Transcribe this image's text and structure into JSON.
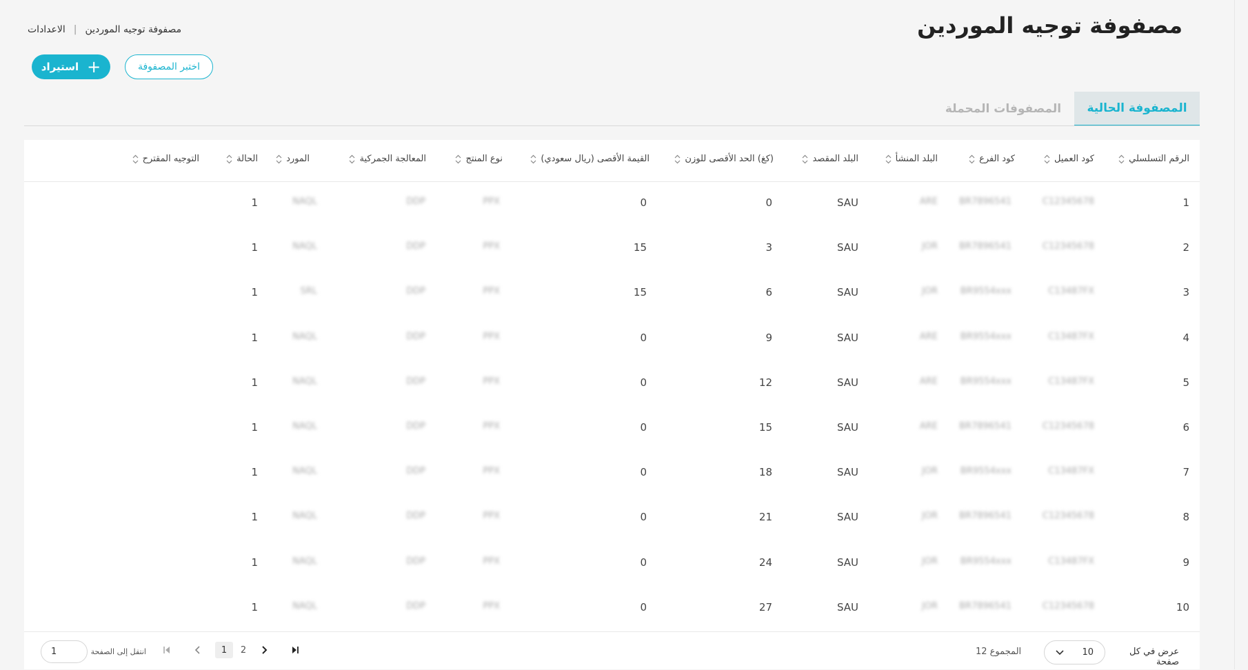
{
  "header": {
    "title": "مصفوفة توجيه الموردين",
    "breadcrumb": [
      "الاعدادات",
      "مصفوفة توجيه الموردين"
    ],
    "breadcrumb_separator": "|"
  },
  "actions": {
    "import_label": "استيراد",
    "choose_matrix_label": "اختبر المصفوفة"
  },
  "tabs": [
    {
      "label": "المصفوفة الحالية",
      "active": true
    },
    {
      "label": "المصفوفات المحملة",
      "active": false
    }
  ],
  "table": {
    "columns": [
      "الرقم التسلسلي",
      "كود العميل",
      "كود الفرع",
      "البلد المنشأ",
      "البلد المقصد",
      "(كغ) الحد الأقصى للوزن",
      "القيمة الأقصى (ريال سعودي)",
      "نوع المنتج",
      "المعالجة الجمركية",
      "المورد",
      "الحالة",
      "التوجيه المقترح"
    ],
    "rows": [
      {
        "serial": "1",
        "client": "C12345678",
        "branch": "BR7896541",
        "origin": "ARE",
        "dest": "SAU",
        "max_weight": "0",
        "max_value": "0",
        "product": "PPX",
        "customs": "DDP",
        "supplier": "NAQL",
        "status": "1"
      },
      {
        "serial": "2",
        "client": "C12345678",
        "branch": "BR7896541",
        "origin": "JOR",
        "dest": "SAU",
        "max_weight": "3",
        "max_value": "15",
        "product": "PPX",
        "customs": "DDP",
        "supplier": "NAQL",
        "status": "1"
      },
      {
        "serial": "3",
        "client": "C13487FX",
        "branch": "BR9554xxx",
        "origin": "JOR",
        "dest": "SAU",
        "max_weight": "6",
        "max_value": "15",
        "product": "PPX",
        "customs": "DDP",
        "supplier": "SRL",
        "status": "1"
      },
      {
        "serial": "4",
        "client": "C13487FX",
        "branch": "BR9554xxx",
        "origin": "ARE",
        "dest": "SAU",
        "max_weight": "9",
        "max_value": "0",
        "product": "PPX",
        "customs": "DDP",
        "supplier": "NAQL",
        "status": "1"
      },
      {
        "serial": "5",
        "client": "C13487FX",
        "branch": "BR9554xxx",
        "origin": "ARE",
        "dest": "SAU",
        "max_weight": "12",
        "max_value": "0",
        "product": "PPX",
        "customs": "DDP",
        "supplier": "NAQL",
        "status": "1"
      },
      {
        "serial": "6",
        "client": "C12345678",
        "branch": "BR7896541",
        "origin": "ARE",
        "dest": "SAU",
        "max_weight": "15",
        "max_value": "0",
        "product": "PPX",
        "customs": "DDP",
        "supplier": "NAQL",
        "status": "1"
      },
      {
        "serial": "7",
        "client": "C13487FX",
        "branch": "BR9554xxx",
        "origin": "JOR",
        "dest": "SAU",
        "max_weight": "18",
        "max_value": "0",
        "product": "PPX",
        "customs": "DDP",
        "supplier": "NAQL",
        "status": "1"
      },
      {
        "serial": "8",
        "client": "C12345678",
        "branch": "BR7896541",
        "origin": "JOR",
        "dest": "SAU",
        "max_weight": "21",
        "max_value": "0",
        "product": "PPX",
        "customs": "DDP",
        "supplier": "NAQL",
        "status": "1"
      },
      {
        "serial": "9",
        "client": "C13487FX",
        "branch": "BR9554xxx",
        "origin": "JOR",
        "dest": "SAU",
        "max_weight": "24",
        "max_value": "0",
        "product": "PPX",
        "customs": "DDP",
        "supplier": "NAQL",
        "status": "1"
      },
      {
        "serial": "10",
        "client": "C12345678",
        "branch": "BR7896541",
        "origin": "JOR",
        "dest": "SAU",
        "max_weight": "27",
        "max_value": "0",
        "product": "PPX",
        "customs": "DDP",
        "supplier": "NAQL",
        "status": "1"
      }
    ]
  },
  "pagination": {
    "per_page_label": "عرض في كل صفحة",
    "per_page_value": "10",
    "total_label": "المجموع 12",
    "pages": [
      "1",
      "2"
    ],
    "current_page": "1",
    "goto_label": "انتقل إلى الصفحة",
    "goto_value": "1"
  },
  "colors": {
    "accent": "#1ab4cf",
    "tab_active_bg": "#dfe6e8",
    "page_bg": "#f5f5f5"
  }
}
